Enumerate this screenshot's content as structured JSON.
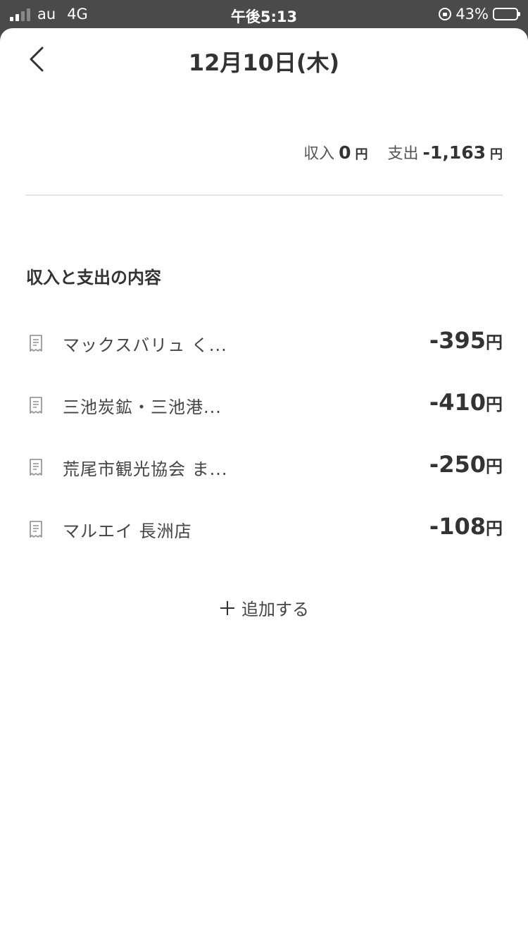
{
  "status_bar": {
    "carrier": "au",
    "network": "4G",
    "time": "午後5:13",
    "battery_text": "43%",
    "battery_level": 0.43
  },
  "header": {
    "title": "12月10日(木)",
    "back_icon": "chevron-left-icon"
  },
  "summary": {
    "income_label": "収入",
    "income_value": "0",
    "income_unit": "円",
    "expense_label": "支出",
    "expense_value": "-1,163",
    "expense_unit": "円"
  },
  "section": {
    "title": "収入と支出の内容"
  },
  "transactions": [
    {
      "name": "マックスバリュ く...",
      "amount": "-395",
      "unit": "円",
      "icon": "receipt-icon"
    },
    {
      "name": "三池炭鉱・三池港...",
      "amount": "-410",
      "unit": "円",
      "icon": "receipt-icon"
    },
    {
      "name": "荒尾市観光協会 ま...",
      "amount": "-250",
      "unit": "円",
      "icon": "receipt-icon"
    },
    {
      "name": "マルエイ 長洲店",
      "amount": "-108",
      "unit": "円",
      "icon": "receipt-icon"
    }
  ],
  "add_button": {
    "label": "追加する",
    "icon": "plus-icon"
  }
}
